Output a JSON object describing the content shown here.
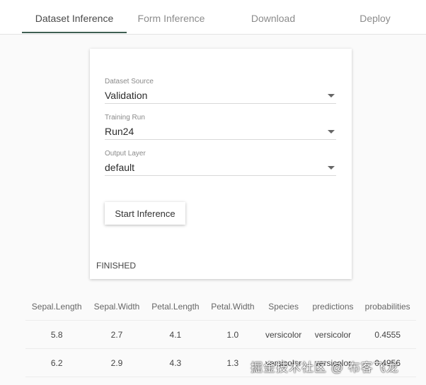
{
  "tabs": [
    {
      "label": "Dataset Inference",
      "active": true
    },
    {
      "label": "Form Inference",
      "active": false
    },
    {
      "label": "Download",
      "active": false
    },
    {
      "label": "Deploy",
      "active": false
    }
  ],
  "form": {
    "dataset_source": {
      "label": "Dataset Source",
      "value": "Validation"
    },
    "training_run": {
      "label": "Training Run",
      "value": "Run24"
    },
    "output_layer": {
      "label": "Output Layer",
      "value": "default"
    },
    "start_button_label": "Start Inference",
    "status": "FINISHED"
  },
  "results": {
    "columns": [
      "Sepal.Length",
      "Sepal.Width",
      "Petal.Length",
      "Petal.Width",
      "Species",
      "predictions",
      "probabilities"
    ],
    "rows": [
      [
        "5.8",
        "2.7",
        "4.1",
        "1.0",
        "versicolor",
        "versicolor",
        "0.4555"
      ],
      [
        "6.2",
        "2.9",
        "4.3",
        "1.3",
        "versicolor",
        "versicolor",
        "0.4956"
      ]
    ]
  },
  "watermark": "掘金技术社区 @ 布客飞龙",
  "colors": {
    "accent": "#3e5f52"
  }
}
